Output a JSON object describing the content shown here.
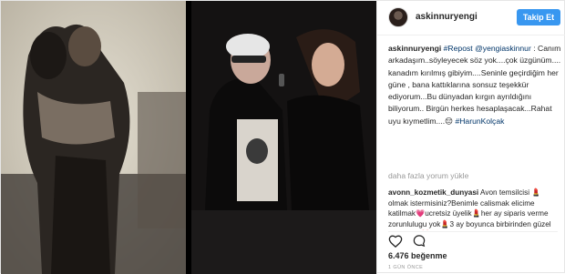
{
  "header": {
    "username": "askinnuryengi",
    "follow_label": "Takip Et"
  },
  "caption": {
    "username": "askinnuryengi",
    "repost": "#Repost",
    "mention": "@yengiaskinnur",
    "text": " : Canım arkadaşım..söyleyecek söz yok....çok üzgünüm.... kanadım kırılmış gibiyim....Seninle geçirdiğim her güne , bana kattıklarına sonsuz teşekkür ediyorum...Bu dünyadan kırgın ayrıldığını biliyorum.. Birgün herkes hesaplaşacak...Rahat uyu kıymetlim....😔 ",
    "hashtag": "#HarunKolçak"
  },
  "more_comments_label": "daha fazla yorum yükle",
  "comment": {
    "username": "avonn_kozmetik_dunyasi",
    "text": "Avon temsilcisi 💄olmak istermisiniz?Benimle calismak elicime katilmak💗ucretsiz üyelik💄her ay siparis verme zorunlulugu yok💄3 ay boyunca birbirinden güzel hediyeler 🎁ciddi"
  },
  "likes": "6.476 beğenme",
  "timestamp": "1 GÜN ÖNCE",
  "colors": {
    "follow_button": "#3897f0",
    "link": "#003569",
    "muted": "#999999"
  },
  "icons": [
    "heart-icon",
    "comment-icon",
    "avatar"
  ]
}
